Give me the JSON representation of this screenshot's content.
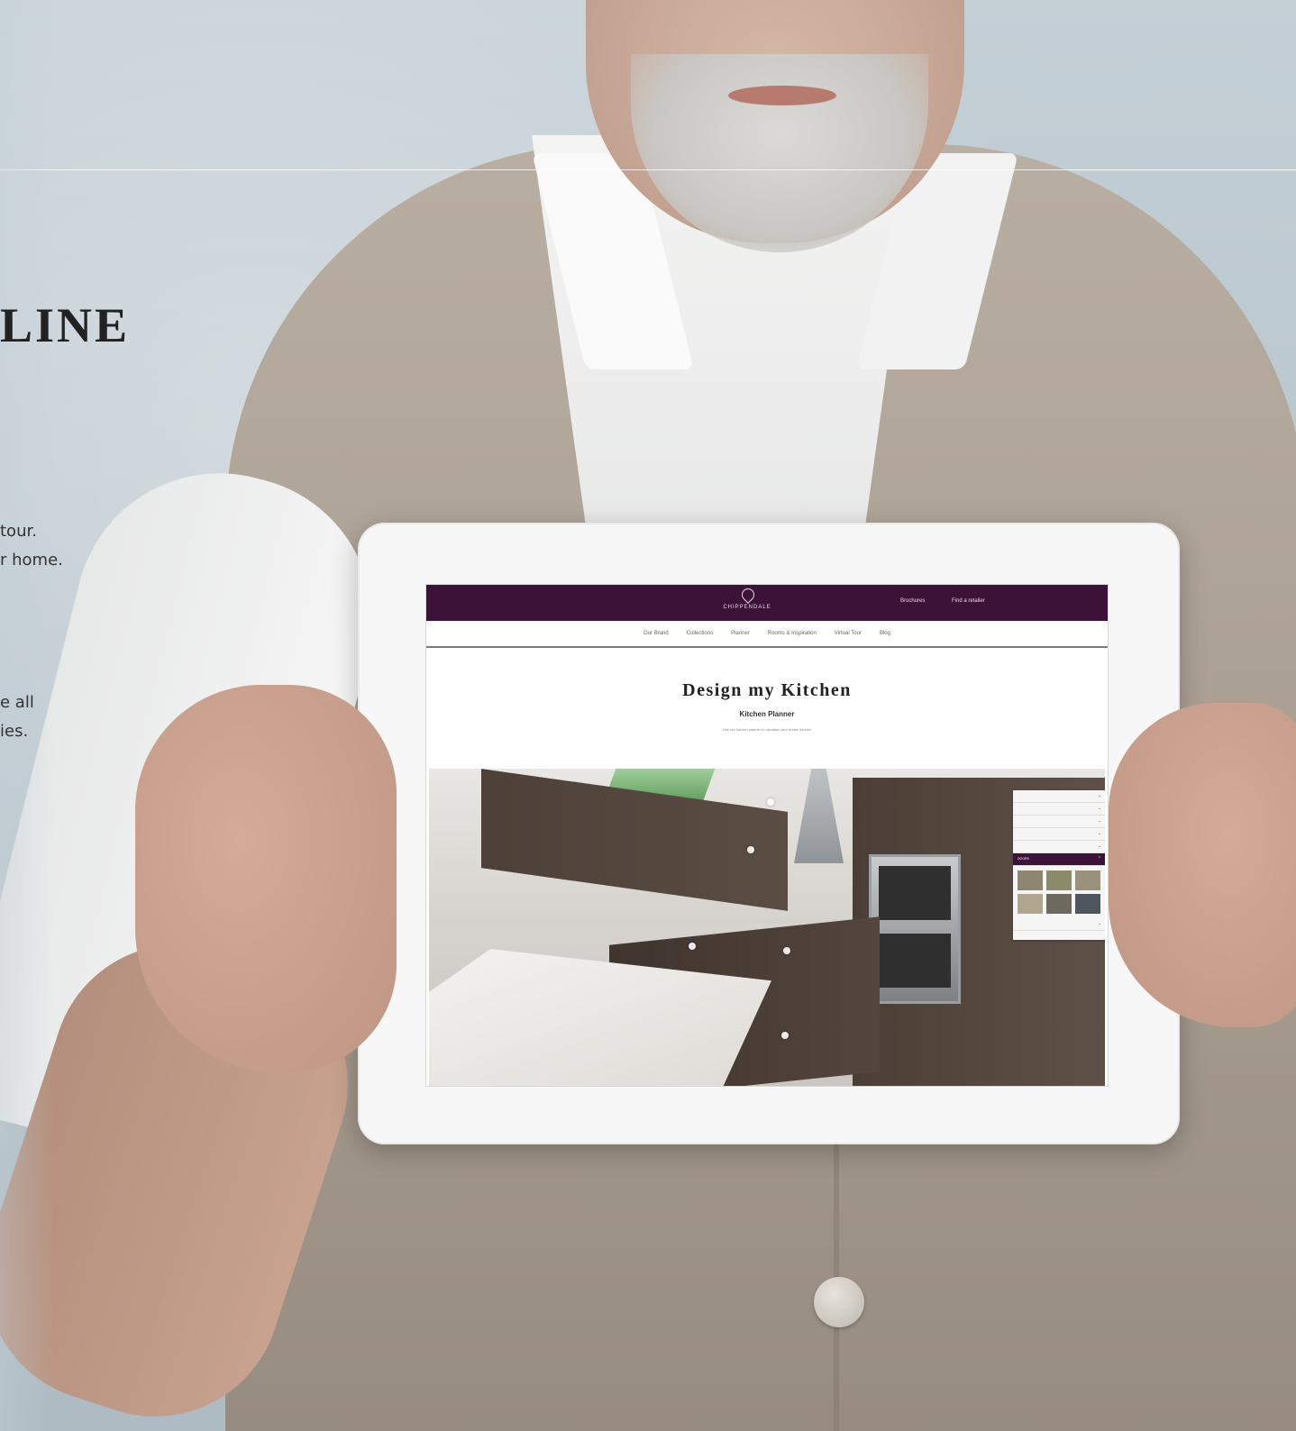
{
  "page": {
    "heading": "LINE",
    "paragraph_1": [
      "tour.",
      "r home."
    ],
    "paragraph_2": [
      "e all",
      "ies."
    ]
  },
  "tablet_site": {
    "brand": "CHIPPENDALE",
    "header_links": [
      "Brochures",
      "Find a retailer"
    ],
    "nav": [
      "Our Brand",
      "Collections",
      "Planner",
      "Rooms & Inspiration",
      "Virtual Tour",
      "Blog"
    ],
    "title": "Design my Kitchen",
    "subtitle": "Kitchen Planner",
    "description": "Use our kitchen planner to visualise your dream kitchen",
    "planner_panel": {
      "active_row": "DOORS"
    }
  },
  "colors": {
    "brand_plum": "#3c1238",
    "wall_blue_grey": "#c4cfd6",
    "cardigan_taupe": "#a69b8f",
    "swatches": [
      "#8f8672",
      "#8b8a6b",
      "#9a917d",
      "#b1a58e",
      "#6c6a5f",
      "#4e5660"
    ]
  }
}
